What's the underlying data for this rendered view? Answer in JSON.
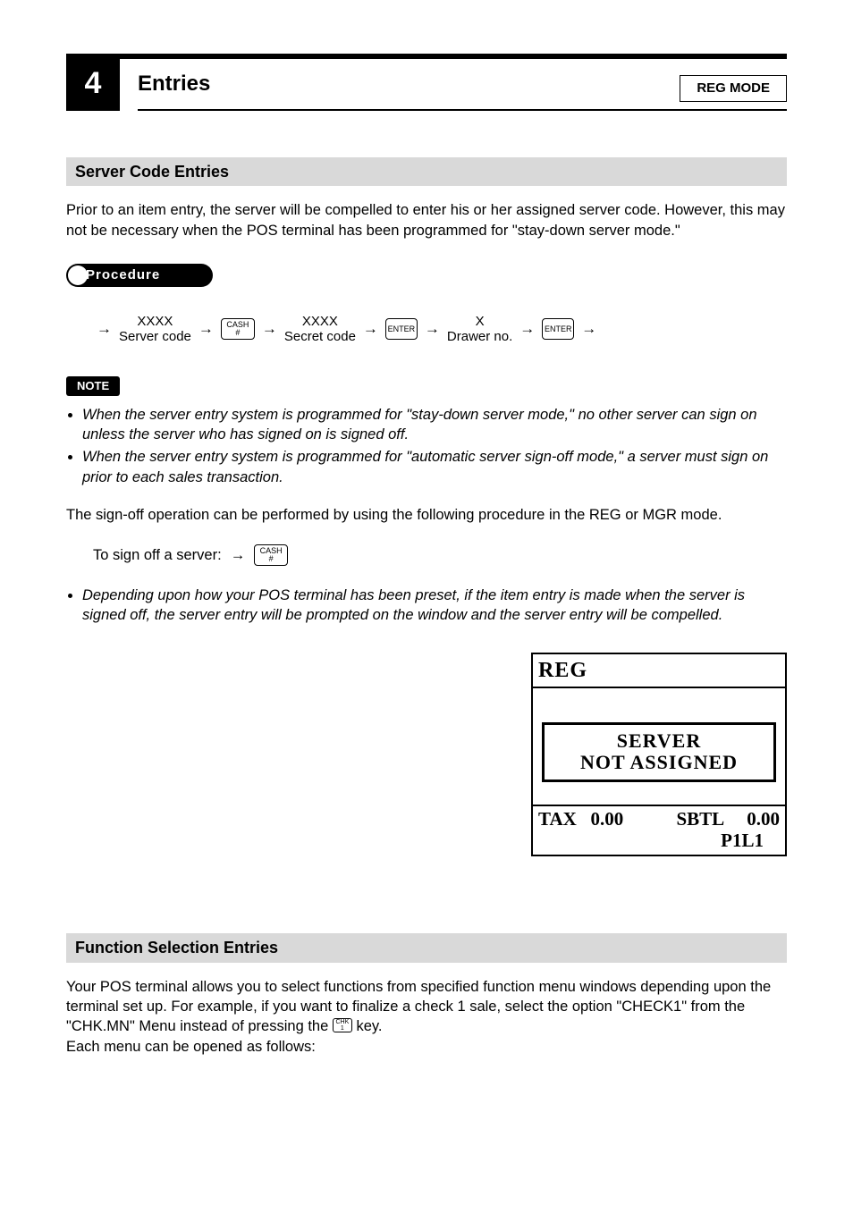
{
  "chapter": {
    "number": "4",
    "title": "Entries",
    "mode": "REG MODE"
  },
  "section1": {
    "heading": "Server Code Entries",
    "intro": "Prior to an item entry, the server will be compelled to enter his or her assigned server code.  However, this may not be necessary when the POS terminal has been programmed for \"stay-down server mode.\"",
    "procedure_label": "Procedure",
    "flow": {
      "step1_l1": "XXXX",
      "step1_l2": "Server code",
      "key1_l1": "CASH",
      "key1_l2": "#",
      "step2_l1": "XXXX",
      "step2_l2": "Secret code",
      "key2": "ENTER",
      "step3_l1": "X",
      "step3_l2": "Drawer no.",
      "key3": "ENTER"
    },
    "note_label": "NOTE",
    "note1": "When the server entry system is programmed for \"stay-down server mode,\" no other server can sign on unless the server who has signed on is signed off.",
    "note2": "When the server entry system is programmed for \"automatic server sign-off mode,\" a server must sign on prior to each sales transaction.",
    "signoff_intro": "The sign-off operation can be performed by using the following procedure in the REG or MGR mode.",
    "signoff_label": "To sign off a server:",
    "signoff_key_l1": "CASH",
    "signoff_key_l2": "#",
    "note3": "Depending upon how your POS terminal has been preset, if the item entry is made when the server is signed off, the server entry will be prompted on the window and the server entry will be compelled.",
    "pos": {
      "mode": "REG",
      "msg_l1": "SERVER",
      "msg_l2": "NOT ASSIGNED",
      "tax_label": "TAX",
      "tax_value": "0.00",
      "sbtl_label": "SBTL",
      "sbtl_value": "0.00",
      "line2": "P1L1"
    }
  },
  "section2": {
    "heading": "Function Selection Entries",
    "p1_before_key": "Your POS terminal allows you to select functions from specified function menu windows depending upon the terminal set up. For example, if you want to finalize a check 1 sale, select the option \"CHECK1\" from the \"CHK.MN\" Menu instead of pressing the ",
    "inline_key_l1": "CHK",
    "inline_key_l2": "1",
    "p1_after_key": " key.",
    "p2": "Each menu can be opened as follows:"
  }
}
